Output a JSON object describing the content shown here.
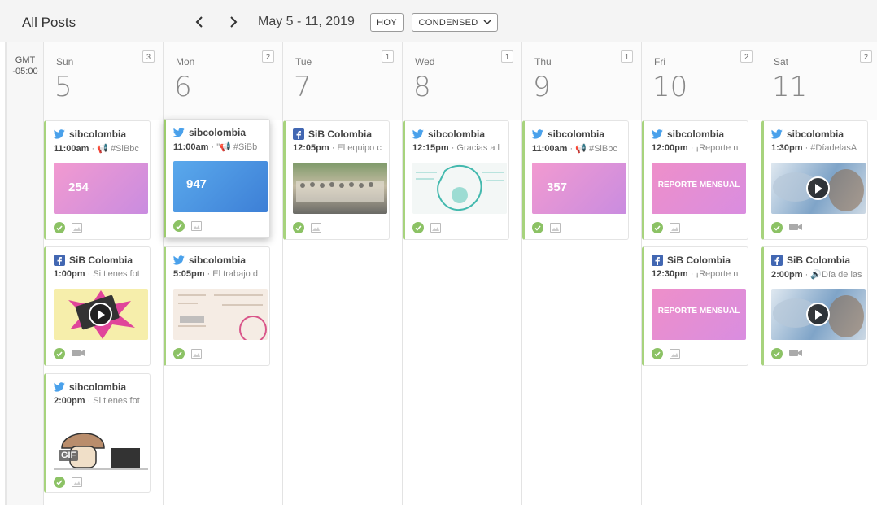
{
  "header": {
    "title": "All Posts",
    "prev_label": "‹",
    "next_label": "›",
    "date_range": "May 5 - 11, 2019",
    "today_button": "HOY",
    "view_button": "CONDENSED"
  },
  "timezone": {
    "line1": "GMT",
    "line2": "-05:00"
  },
  "days": [
    {
      "name": "Sun",
      "num": "5",
      "count": "3",
      "posts": [
        {
          "network": "twitter",
          "account": "sibcolombia",
          "time": "11:00am",
          "text": " · 📢 #SiBbc",
          "thumb": "pink-stat",
          "thumb_value": "254",
          "media": "image"
        },
        {
          "network": "facebook",
          "account": "SiB Colombia",
          "time": "1:00pm",
          "text": " · Si tienes fot",
          "thumb": "video-laptop",
          "media": "video"
        },
        {
          "network": "twitter",
          "account": "sibcolombia",
          "time": "2:00pm",
          "text": " · Si tienes fot",
          "thumb": "gif-mushroom",
          "gif_label": "GIF",
          "media": "image"
        }
      ]
    },
    {
      "name": "Mon",
      "num": "6",
      "count": "2",
      "posts": [
        {
          "network": "twitter",
          "account": "sibcolombia",
          "time": "11:00am",
          "text": " · \"📢 #SiBb",
          "thumb": "blue-stat",
          "thumb_value": "947",
          "media": "image",
          "raised": true
        },
        {
          "network": "twitter",
          "account": "sibcolombia",
          "time": "5:05pm",
          "text": " · El trabajo d",
          "thumb": "infographic-global",
          "media": "image"
        }
      ]
    },
    {
      "name": "Tue",
      "num": "7",
      "count": "1",
      "posts": [
        {
          "network": "facebook",
          "account": "SiB Colombia",
          "time": "12:05pm",
          "text": " · El equipo c",
          "thumb": "photo-group",
          "media": "image"
        }
      ]
    },
    {
      "name": "Wed",
      "num": "8",
      "count": "1",
      "posts": [
        {
          "network": "twitter",
          "account": "sibcolombia",
          "time": "12:15pm",
          "text": " · Gracias a l",
          "thumb": "teal-illustration",
          "media": "image"
        }
      ]
    },
    {
      "name": "Thu",
      "num": "9",
      "count": "1",
      "posts": [
        {
          "network": "twitter",
          "account": "sibcolombia",
          "time": "11:00am",
          "text": " · 📢 #SiBbc",
          "thumb": "pink-stat",
          "thumb_value": "357",
          "media": "image"
        }
      ]
    },
    {
      "name": "Fri",
      "num": "10",
      "count": "2",
      "posts": [
        {
          "network": "twitter",
          "account": "sibcolombia",
          "time": "12:00pm",
          "text": " · ¡Reporte n",
          "thumb": "report",
          "thumb_title": "REPORTE MENSUAL",
          "media": "image"
        },
        {
          "network": "facebook",
          "account": "SiB Colombia",
          "time": "12:30pm",
          "text": " · ¡Reporte n",
          "thumb": "report",
          "thumb_title": "REPORTE MENSUAL",
          "media": "image"
        }
      ]
    },
    {
      "name": "Sat",
      "num": "11",
      "count": "2",
      "posts": [
        {
          "network": "twitter",
          "account": "sibcolombia",
          "time": "1:30pm",
          "text": " · #DíadelasA",
          "thumb": "video-bird",
          "media": "video"
        },
        {
          "network": "facebook",
          "account": "SiB Colombia",
          "time": "2:00pm",
          "text": " · 🔊Día de las",
          "thumb": "video-bird",
          "media": "video"
        }
      ]
    }
  ]
}
